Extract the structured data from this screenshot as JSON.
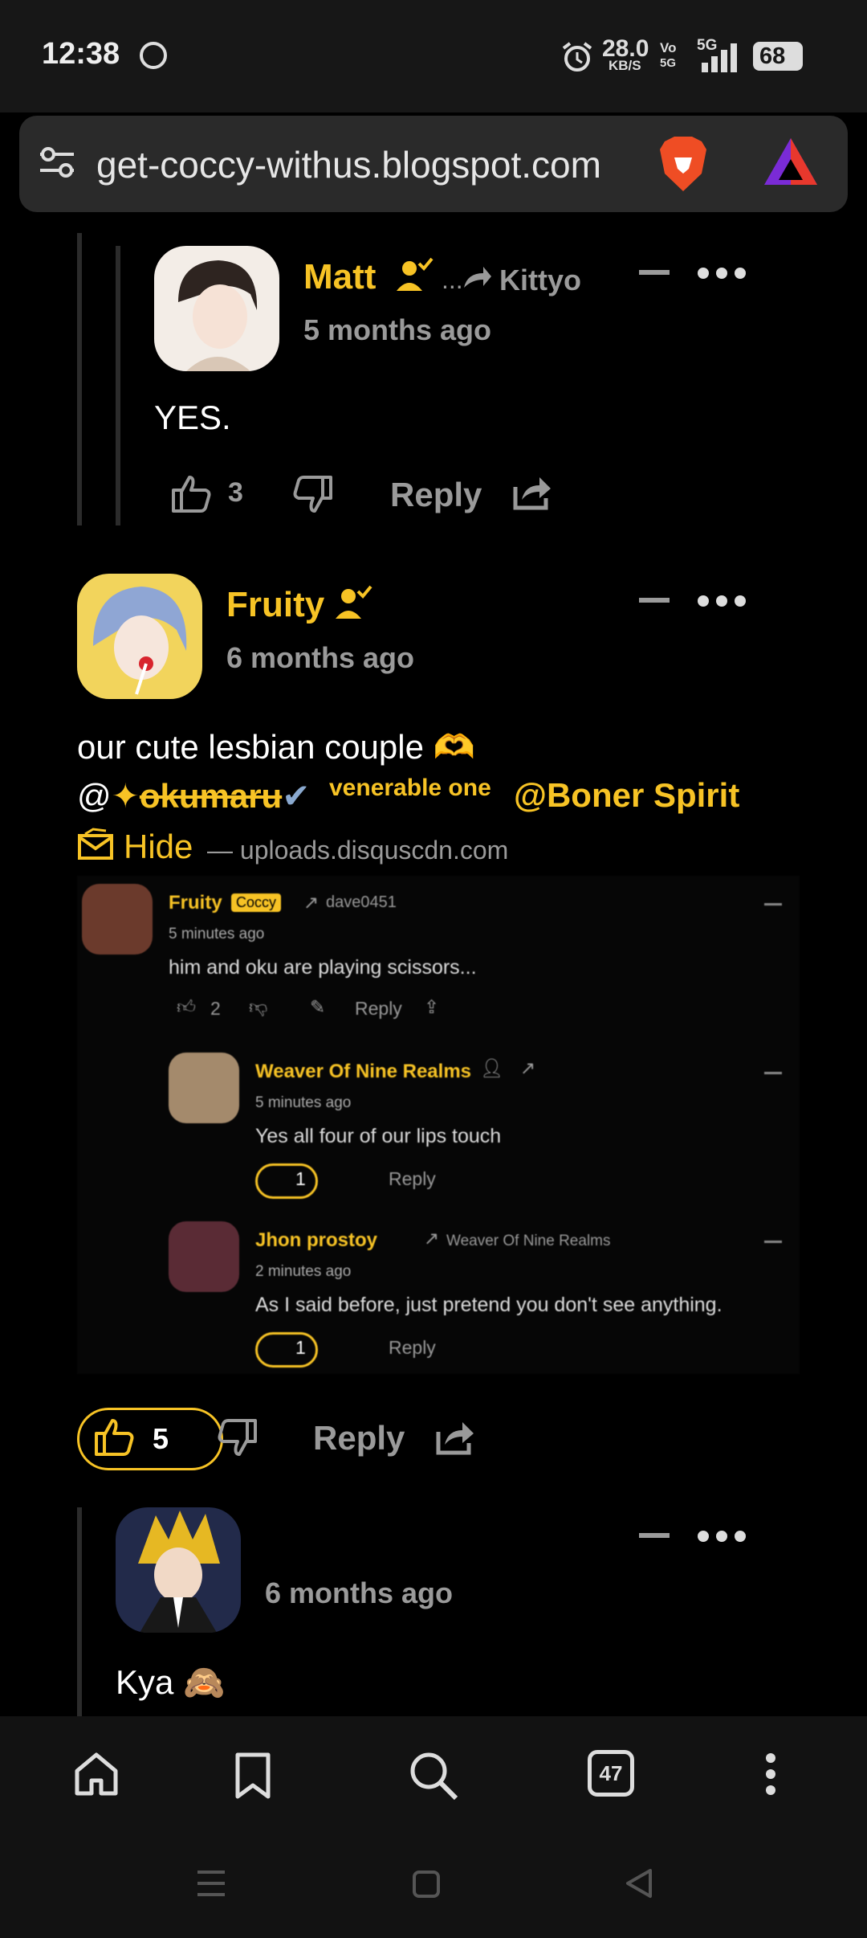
{
  "status": {
    "time": "12:38",
    "speed": "28.0",
    "speed_unit": "KB/S",
    "vo": "Vo",
    "vo2": "5G",
    "net": "5G",
    "battery": "68"
  },
  "browser": {
    "url": "get-coccy-withus.blogspot.com",
    "tabs_count": "47"
  },
  "comments": {
    "matt": {
      "name": "Matt",
      "reply_to": "Kittyo",
      "reply_prefix": "...",
      "time": "5 months ago",
      "body": "YES.",
      "likes": "3",
      "reply_label": "Reply"
    },
    "fruity": {
      "name": "Fruity",
      "time": "6 months ago",
      "body_line1": "our cute lesbian couple 🫶",
      "mention1_at": "@",
      "mention1_star": "✦",
      "mention1_name": "okumaru",
      "mention1_check": "✔",
      "mention1_badge": "venerable one",
      "mention2": "@Boner Spirit",
      "hide_label": "Hide",
      "source": "— uploads.disquscdn.com",
      "likes": "5",
      "reply_label": "Reply"
    },
    "third": {
      "time": "6 months ago",
      "body": "Kya 🙈"
    }
  },
  "embedded": {
    "c1": {
      "name": "Fruity",
      "badge": "Coccy",
      "reply_to": "dave0451",
      "time": "5 minutes ago",
      "body": "him and oku are playing scissors...",
      "likes": "2",
      "reply": "Reply"
    },
    "c2": {
      "name": "Weaver Of Nine Realms",
      "time": "5 minutes ago",
      "body": "Yes all four of our lips touch",
      "likes": "1",
      "reply": "Reply"
    },
    "c3": {
      "name": "Jhon prostoy",
      "reply_to": "Weaver Of Nine Realms",
      "time": "2 minutes ago",
      "body": "As I said before, just pretend you don't see anything.",
      "likes": "1",
      "reply": "Reply"
    }
  },
  "colors": {
    "accent": "#f7c325",
    "background": "#000000",
    "bar": "#171717"
  }
}
